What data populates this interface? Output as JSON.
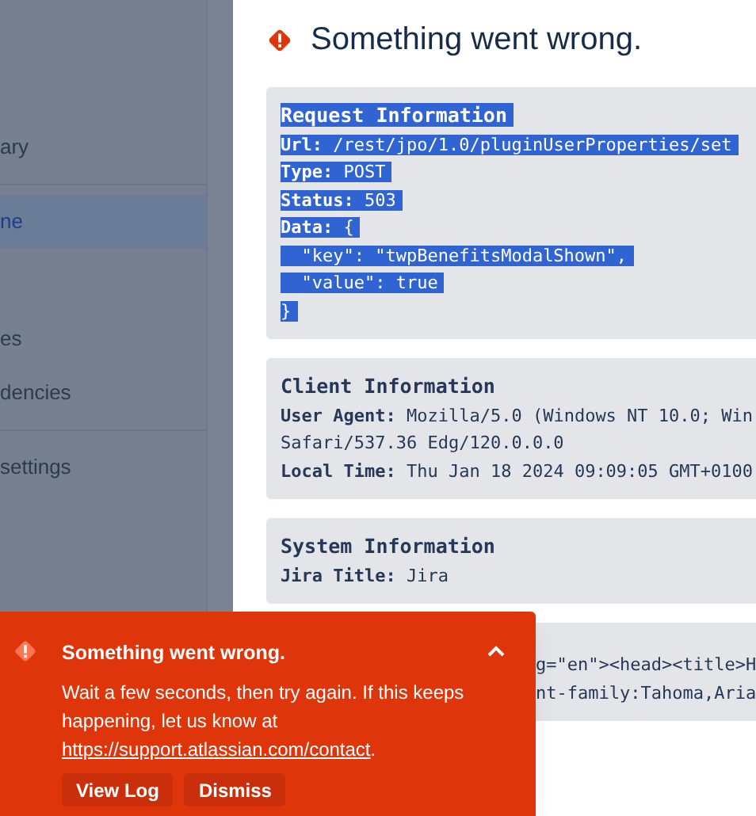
{
  "sidebar": {
    "items": [
      {
        "label": "ary",
        "selected": false,
        "divider_after": true
      },
      {
        "label": "ne",
        "selected": true,
        "divider_after": false
      },
      {
        "label": "es",
        "selected": false,
        "divider_after": false
      },
      {
        "label": "dencies",
        "selected": false,
        "divider_after": true
      },
      {
        "label": "settings",
        "selected": false,
        "divider_after": false
      }
    ]
  },
  "heading": "Something went wrong.",
  "blocks": [
    {
      "highlighted": true,
      "title": "Request Information",
      "lines": [
        "**Url:** /rest/jpo/1.0/pluginUserProperties/set",
        "**Type:** POST",
        "**Status:** 503",
        "**Data:** {",
        "  \"key\": \"twpBenefitsModalShown\",",
        "  \"value\": true",
        "}"
      ]
    },
    {
      "highlighted": false,
      "title": "Client Information",
      "lines": [
        "**User Agent:** Mozilla/5.0 (Windows NT 10.0; Win",
        "Safari/537.36 Edg/120.0.0.0",
        "**Local Time:** Thu Jan 18 2024 09:09:05 GMT+0100"
      ]
    },
    {
      "highlighted": false,
      "title": "System Information",
      "lines": [
        "**Jira Title:** Jira"
      ]
    },
    {
      "highlighted": false,
      "lines": [
        "g=\"en\"><head><title>H",
        "nt-family:Tahoma,Aria"
      ]
    }
  ],
  "flag": {
    "title": "Something went wrong.",
    "expanded": true,
    "body": "Wait a few seconds, then try again. If this keeps happening, let us know at",
    "link": "https://support.atlassian.com/contact",
    "after_link": ".",
    "actions": [
      "View Log",
      "Dismiss"
    ]
  }
}
